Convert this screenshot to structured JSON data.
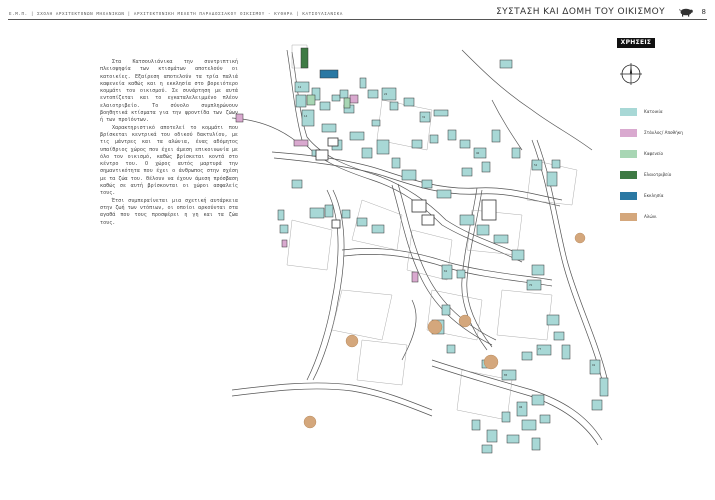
{
  "header": {
    "breadcrumb": "Ε.Μ.Π. | ΣΧΟΛΗ ΑΡΧΙΤΕΚΤΟΝΩΝ ΜΗΧΑΝΙΚΩΝ | ΑΡΧΙΤΕΚΤΟΝΙΚΗ ΜΕΛΕΤΗ ΠΑΡΑΔΟΣΙΑΚΟΥ ΟΙΚΙΣΜΟΥ - ΚΥΘΗΡΑ | ΚΑΤΣΟΥΛΙΑΝΙΚΑ",
    "title": "ΣΥΣΤΑΣΗ ΚΑΙ ΔΟΜΗ ΤΟΥ ΟΙΚΙΣΜΟΥ",
    "page_number": "8",
    "logo_icon": "pig-logo-icon"
  },
  "body": {
    "paragraphs": [
      "Στα Κατσουλιάνικα την συντριπτική πλειοψηφία των κτισμάτων αποτελούν οι κατοικίες. Εξαίρεση αποτελούν τα τρία παλιά καφενεία καθώς και η εκκλησία στο βορειότερο κομμάτι του οικισμού. Σε συνάρτηση με αυτά εντοπίζεται και το εγκαταλελειμμένο πλέον ελαιοτριβείο. Το σύνολο συμπληρώνουν βοηθητικά κτίσματα για την φροντίδα των ζώων ή των προϊόντων.",
      "Χαρακτηριστικό αποτελεί το κομμάτι που βρίσκεται κεντρικά του οδικού δακτυλίου, με τις μάντρες και τα αλώνια, ένας αδόμητος υπαίθριος χώρος που έχει άμεση επικοινωνία με όλο τον οικισμό, καθώς βρίσκεται κοντά στο κέντρο του. Ο χώρος αυτός μαρτυρά την σημαντικότητα που έχει ο άνθρωπος στην σχέση με τα ζώα του. Θέλουν να έχουν άμεση πρόσβαση καθώς σε αυτή βρίσκονται οι χώροι ασφαλείς τους.",
      "Έτσι συμπεραίνεται μια σχετική αυτάρκεια στην ζωή των ντόπιων, οι οποίοι αρκούνται στα αγαθά που τους προσφέρει η γη και τα ζώα τους."
    ]
  },
  "legend": {
    "title": "ΧΡΗΣΕΙΣ",
    "north_icon": "north-compass-icon",
    "items": [
      {
        "label": "Κατοικία",
        "color": "#a8d8d6"
      },
      {
        "label": "Στάυλος/ Αποθήκη",
        "color": "#d9a9cf"
      },
      {
        "label": "Καφενείο",
        "color": "#a8d6b4"
      },
      {
        "label": "Ελαιοτριβείο",
        "color": "#3e7a44"
      },
      {
        "label": "Εκκλησία",
        "color": "#2a78a3"
      },
      {
        "label": "Αλώνι",
        "color": "#d4a77c"
      }
    ]
  }
}
